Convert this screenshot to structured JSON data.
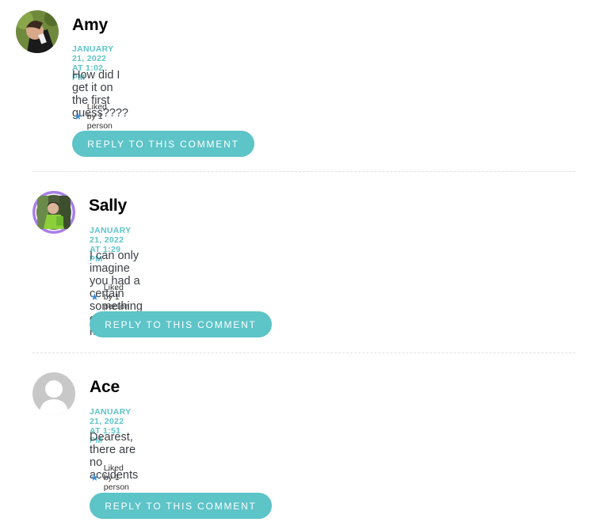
{
  "comments": [
    {
      "author": "Amy",
      "date": "JANUARY 21, 2022 AT 1:02 PM",
      "text": "How did I get it on the first guess????",
      "likes": "Liked by 1 person",
      "reply_label": "REPLY TO THIS COMMENT",
      "star_icon": "star-icon"
    },
    {
      "author": "Sally",
      "date": "JANUARY 21, 2022 AT 1:29 PM",
      "text": "I can only imagine you had a certain something on your mind?",
      "likes": "Liked by 1 person",
      "reply_label": "REPLY TO THIS COMMENT",
      "star_icon": "star-icon"
    },
    {
      "author": "Ace",
      "date": "JANUARY 21, 2022 AT 1:51 PM",
      "text": "Dearest, there are no accidents",
      "likes": "Liked by 1 person",
      "reply_label": "REPLY TO THIS COMMENT",
      "star_icon": "star-icon"
    }
  ],
  "colors": {
    "accent": "#5dc4c8",
    "star": "#3d8ad3",
    "author": "#000000",
    "text": "#3a3f44"
  }
}
